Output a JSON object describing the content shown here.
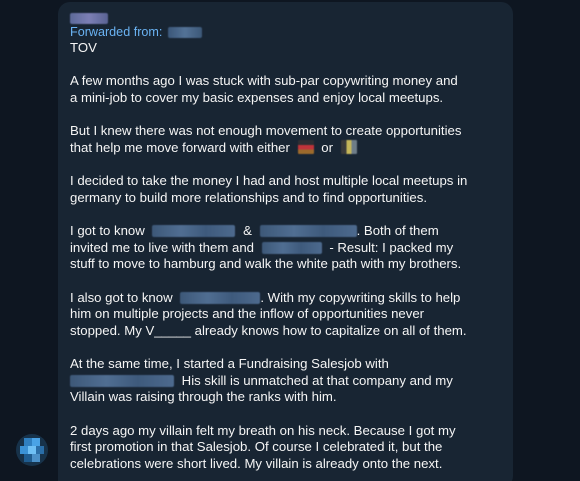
{
  "message": {
    "forwarded_label": "Forwarded from:",
    "title": "TOV",
    "p1": {
      "l1": "A few months ago I was stuck with sub-par copywriting money and",
      "l2": "a mini-job to cover my basic expenses and enjoy local meetups."
    },
    "p2": {
      "l1": "But I knew there was not enough movement to create opportunities",
      "l2a": "that help me move forward with either",
      "l2b": "or"
    },
    "p3": {
      "l1": "I decided to take the money I had and host multiple local meetups in",
      "l2": "germany to build more relationships and to find opportunities."
    },
    "p4": {
      "l1a": "I got to know",
      "l1b": "&",
      "l1c": ". Both of them",
      "l2a": "invited me to live with them and",
      "l2b": "- Result: I packed my",
      "l3": "stuff to move to hamburg and walk the white path with my brothers."
    },
    "p5": {
      "l1a": "I also got to know",
      "l1b": ". With my copywriting skills to help",
      "l2": "him on multiple projects and the inflow of opportunities never",
      "l3": "stopped. My V_____ already knows how to capitalize on all of them."
    },
    "p6": {
      "l1": "At the same time, I started a Fundraising Salesjob with",
      "l2b": "His skill is unmatched at that company and my",
      "l3": "Villain was raising through the ranks with him."
    },
    "p7": {
      "l1": "2 days ago my villain felt my breath on his neck. Because I got my",
      "l2": "first promotion in that Salesjob. Of course I celebrated it, but the",
      "l3": "celebrations were short lived. My villain is already onto the next."
    }
  },
  "colors": {
    "background": "#0e1621",
    "bubble": "#182533",
    "text": "#f5f5f5",
    "link_accent": "#6ab3f3"
  },
  "icons": {
    "flag_1": "germany-flag-icon",
    "flag_2": "belgium-flag-icon"
  }
}
